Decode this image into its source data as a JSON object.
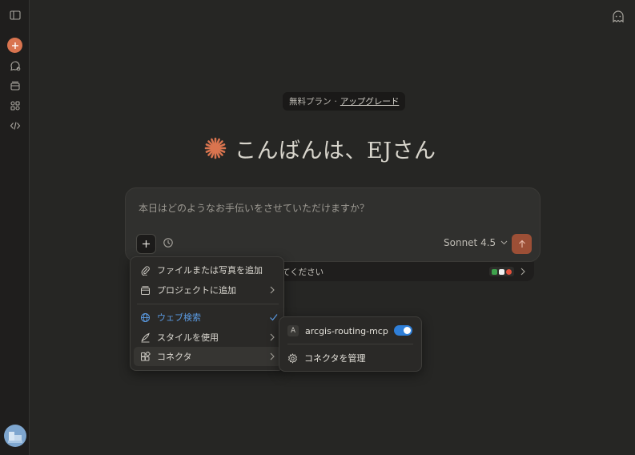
{
  "sidebar": {
    "items": [
      {
        "icon": "sidebar-toggle-icon"
      },
      {
        "icon": "new-chat-plus-icon"
      },
      {
        "icon": "chats-search-icon"
      },
      {
        "icon": "projects-icon"
      },
      {
        "icon": "artifacts-icon"
      },
      {
        "icon": "code-icon"
      }
    ],
    "avatar_icon": "user-avatar"
  },
  "header": {
    "ghost_icon": "incognito-ghost-icon"
  },
  "plan": {
    "label": "無料プラン",
    "separator": "·",
    "upgrade": "アップグレード"
  },
  "greeting": {
    "text": "こんばんは、EJさん"
  },
  "composer": {
    "placeholder": "本日はどのようなお手伝いをさせていただけますか？",
    "model": "Sonnet 4.5"
  },
  "tray": {
    "text": "てください"
  },
  "menu": {
    "items": [
      {
        "label": "ファイルまたは写真を追加",
        "icon": "paperclip-icon"
      },
      {
        "label": "プロジェクトに追加",
        "icon": "project-folder-icon",
        "submenu": true
      },
      {
        "label": "ウェブ検索",
        "icon": "globe-icon",
        "checked": true
      },
      {
        "label": "スタイルを使用",
        "icon": "pen-style-icon",
        "submenu": true
      },
      {
        "label": "コネクタ",
        "icon": "connectors-icon",
        "submenu": true
      }
    ]
  },
  "submenu": {
    "connector_badge": "A",
    "connector_name": "arcgis-routing-mcp",
    "connector_enabled": true,
    "manage_label": "コネクタを管理"
  },
  "colors": {
    "accent": "#d9744f",
    "send": "#9c4f36",
    "toggle": "#2f7fd8",
    "active_link": "#5b9be3"
  }
}
